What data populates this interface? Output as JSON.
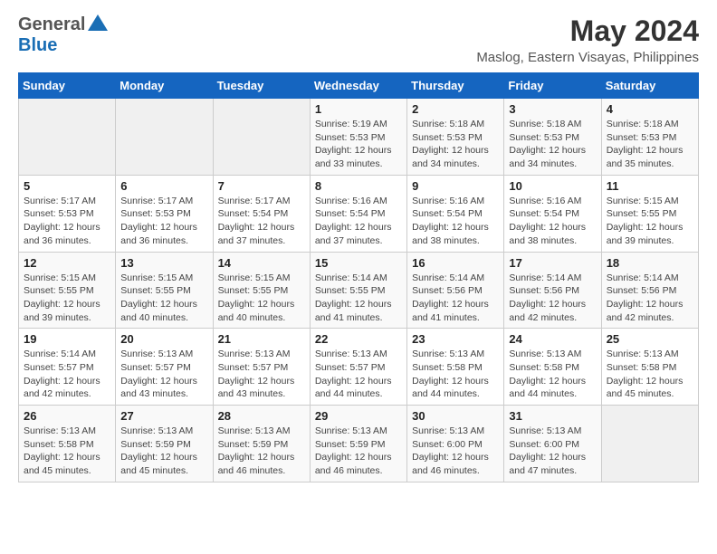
{
  "header": {
    "logo_general": "General",
    "logo_blue": "Blue",
    "title": "May 2024",
    "subtitle": "Maslog, Eastern Visayas, Philippines"
  },
  "calendar": {
    "days_of_week": [
      "Sunday",
      "Monday",
      "Tuesday",
      "Wednesday",
      "Thursday",
      "Friday",
      "Saturday"
    ],
    "weeks": [
      [
        {
          "day": "",
          "info": ""
        },
        {
          "day": "",
          "info": ""
        },
        {
          "day": "",
          "info": ""
        },
        {
          "day": "1",
          "sunrise": "Sunrise: 5:19 AM",
          "sunset": "Sunset: 5:53 PM",
          "daylight": "Daylight: 12 hours and 33 minutes."
        },
        {
          "day": "2",
          "sunrise": "Sunrise: 5:18 AM",
          "sunset": "Sunset: 5:53 PM",
          "daylight": "Daylight: 12 hours and 34 minutes."
        },
        {
          "day": "3",
          "sunrise": "Sunrise: 5:18 AM",
          "sunset": "Sunset: 5:53 PM",
          "daylight": "Daylight: 12 hours and 34 minutes."
        },
        {
          "day": "4",
          "sunrise": "Sunrise: 5:18 AM",
          "sunset": "Sunset: 5:53 PM",
          "daylight": "Daylight: 12 hours and 35 minutes."
        }
      ],
      [
        {
          "day": "5",
          "sunrise": "Sunrise: 5:17 AM",
          "sunset": "Sunset: 5:53 PM",
          "daylight": "Daylight: 12 hours and 36 minutes."
        },
        {
          "day": "6",
          "sunrise": "Sunrise: 5:17 AM",
          "sunset": "Sunset: 5:53 PM",
          "daylight": "Daylight: 12 hours and 36 minutes."
        },
        {
          "day": "7",
          "sunrise": "Sunrise: 5:17 AM",
          "sunset": "Sunset: 5:54 PM",
          "daylight": "Daylight: 12 hours and 37 minutes."
        },
        {
          "day": "8",
          "sunrise": "Sunrise: 5:16 AM",
          "sunset": "Sunset: 5:54 PM",
          "daylight": "Daylight: 12 hours and 37 minutes."
        },
        {
          "day": "9",
          "sunrise": "Sunrise: 5:16 AM",
          "sunset": "Sunset: 5:54 PM",
          "daylight": "Daylight: 12 hours and 38 minutes."
        },
        {
          "day": "10",
          "sunrise": "Sunrise: 5:16 AM",
          "sunset": "Sunset: 5:54 PM",
          "daylight": "Daylight: 12 hours and 38 minutes."
        },
        {
          "day": "11",
          "sunrise": "Sunrise: 5:15 AM",
          "sunset": "Sunset: 5:55 PM",
          "daylight": "Daylight: 12 hours and 39 minutes."
        }
      ],
      [
        {
          "day": "12",
          "sunrise": "Sunrise: 5:15 AM",
          "sunset": "Sunset: 5:55 PM",
          "daylight": "Daylight: 12 hours and 39 minutes."
        },
        {
          "day": "13",
          "sunrise": "Sunrise: 5:15 AM",
          "sunset": "Sunset: 5:55 PM",
          "daylight": "Daylight: 12 hours and 40 minutes."
        },
        {
          "day": "14",
          "sunrise": "Sunrise: 5:15 AM",
          "sunset": "Sunset: 5:55 PM",
          "daylight": "Daylight: 12 hours and 40 minutes."
        },
        {
          "day": "15",
          "sunrise": "Sunrise: 5:14 AM",
          "sunset": "Sunset: 5:55 PM",
          "daylight": "Daylight: 12 hours and 41 minutes."
        },
        {
          "day": "16",
          "sunrise": "Sunrise: 5:14 AM",
          "sunset": "Sunset: 5:56 PM",
          "daylight": "Daylight: 12 hours and 41 minutes."
        },
        {
          "day": "17",
          "sunrise": "Sunrise: 5:14 AM",
          "sunset": "Sunset: 5:56 PM",
          "daylight": "Daylight: 12 hours and 42 minutes."
        },
        {
          "day": "18",
          "sunrise": "Sunrise: 5:14 AM",
          "sunset": "Sunset: 5:56 PM",
          "daylight": "Daylight: 12 hours and 42 minutes."
        }
      ],
      [
        {
          "day": "19",
          "sunrise": "Sunrise: 5:14 AM",
          "sunset": "Sunset: 5:57 PM",
          "daylight": "Daylight: 12 hours and 42 minutes."
        },
        {
          "day": "20",
          "sunrise": "Sunrise: 5:13 AM",
          "sunset": "Sunset: 5:57 PM",
          "daylight": "Daylight: 12 hours and 43 minutes."
        },
        {
          "day": "21",
          "sunrise": "Sunrise: 5:13 AM",
          "sunset": "Sunset: 5:57 PM",
          "daylight": "Daylight: 12 hours and 43 minutes."
        },
        {
          "day": "22",
          "sunrise": "Sunrise: 5:13 AM",
          "sunset": "Sunset: 5:57 PM",
          "daylight": "Daylight: 12 hours and 44 minutes."
        },
        {
          "day": "23",
          "sunrise": "Sunrise: 5:13 AM",
          "sunset": "Sunset: 5:58 PM",
          "daylight": "Daylight: 12 hours and 44 minutes."
        },
        {
          "day": "24",
          "sunrise": "Sunrise: 5:13 AM",
          "sunset": "Sunset: 5:58 PM",
          "daylight": "Daylight: 12 hours and 44 minutes."
        },
        {
          "day": "25",
          "sunrise": "Sunrise: 5:13 AM",
          "sunset": "Sunset: 5:58 PM",
          "daylight": "Daylight: 12 hours and 45 minutes."
        }
      ],
      [
        {
          "day": "26",
          "sunrise": "Sunrise: 5:13 AM",
          "sunset": "Sunset: 5:58 PM",
          "daylight": "Daylight: 12 hours and 45 minutes."
        },
        {
          "day": "27",
          "sunrise": "Sunrise: 5:13 AM",
          "sunset": "Sunset: 5:59 PM",
          "daylight": "Daylight: 12 hours and 45 minutes."
        },
        {
          "day": "28",
          "sunrise": "Sunrise: 5:13 AM",
          "sunset": "Sunset: 5:59 PM",
          "daylight": "Daylight: 12 hours and 46 minutes."
        },
        {
          "day": "29",
          "sunrise": "Sunrise: 5:13 AM",
          "sunset": "Sunset: 5:59 PM",
          "daylight": "Daylight: 12 hours and 46 minutes."
        },
        {
          "day": "30",
          "sunrise": "Sunrise: 5:13 AM",
          "sunset": "Sunset: 6:00 PM",
          "daylight": "Daylight: 12 hours and 46 minutes."
        },
        {
          "day": "31",
          "sunrise": "Sunrise: 5:13 AM",
          "sunset": "Sunset: 6:00 PM",
          "daylight": "Daylight: 12 hours and 47 minutes."
        },
        {
          "day": "",
          "info": ""
        }
      ]
    ]
  }
}
